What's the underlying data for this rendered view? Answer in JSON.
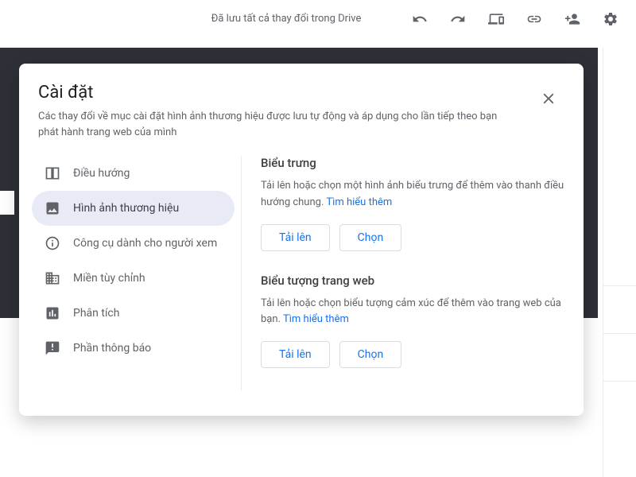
{
  "toolbar": {
    "status": "Đã lưu tất cả thay đổi trong Drive"
  },
  "modal": {
    "title": "Cài đặt",
    "subtitle": "Các thay đổi về mục cài đặt hình ảnh thương hiệu được lưu tự động và áp dụng cho lần tiếp theo bạn phát hành trang web của mình",
    "sidebar": {
      "items": [
        {
          "label": "Điều hướng"
        },
        {
          "label": "Hình ảnh thương hiệu"
        },
        {
          "label": "Công cụ dành cho người xem"
        },
        {
          "label": "Miền tùy chỉnh"
        },
        {
          "label": "Phân tích"
        },
        {
          "label": "Phần thông báo"
        }
      ]
    },
    "sections": {
      "logo": {
        "title": "Biểu trưng",
        "desc_prefix": "Tải lên hoặc chọn một hình ảnh biểu trưng để thêm vào thanh điều hướng chung. ",
        "learn_more": "Tìm hiểu thêm",
        "upload": "Tải lên",
        "choose": "Chọn"
      },
      "favicon": {
        "title": "Biểu tượng trang web",
        "desc_prefix": "Tải lên hoặc chọn biểu tượng cảm xúc để thêm vào trang web của bạn. ",
        "learn_more": "Tìm hiểu thêm",
        "upload": "Tải lên",
        "choose": "Chọn"
      }
    }
  }
}
